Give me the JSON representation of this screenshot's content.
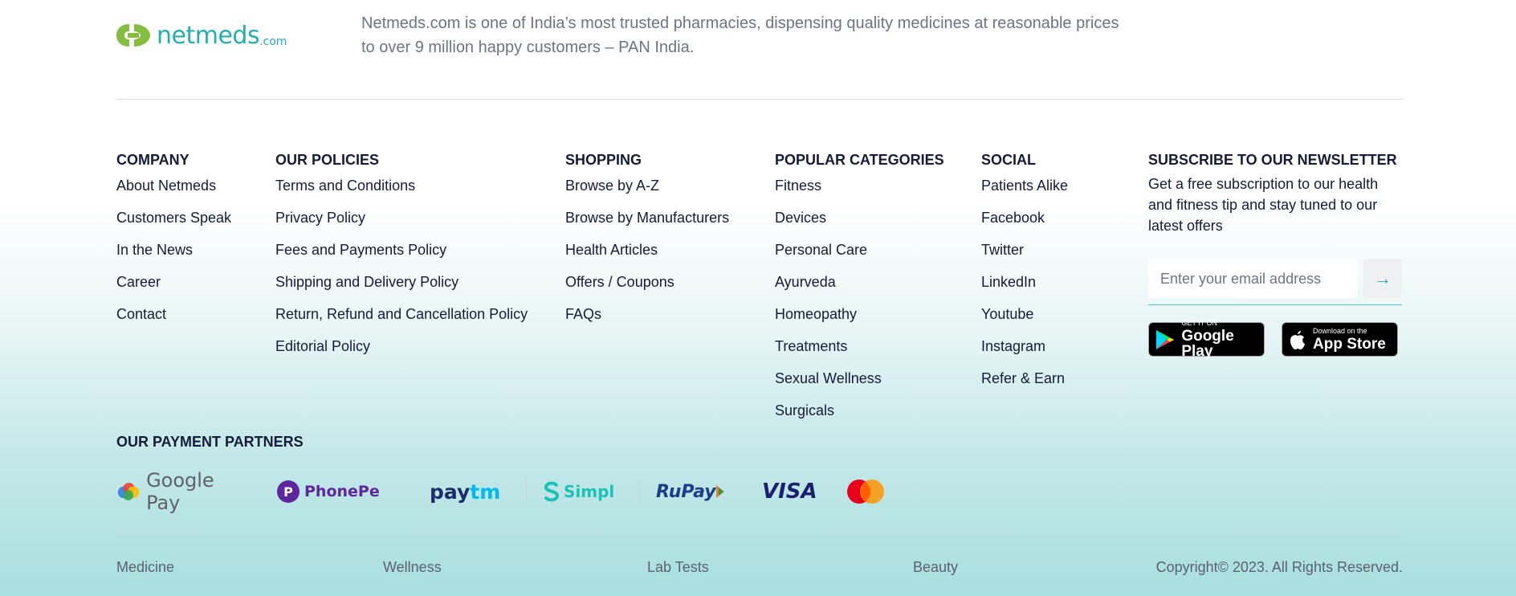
{
  "brand": {
    "name": "netmeds",
    "suffix": ".com",
    "color": "#24aeb1",
    "leaf_color": "#84be41"
  },
  "about": "Netmeds.com is one of India’s most trusted pharmacies, dispensing quality medicines at reasonable prices to over 9 million happy customers – PAN India.",
  "columns": {
    "company": {
      "title": "COMPANY",
      "links": [
        "About Netmeds",
        "Customers Speak",
        "In the News",
        "Career",
        "Contact"
      ]
    },
    "policies": {
      "title": "OUR POLICIES",
      "links": [
        "Terms and Conditions",
        "Privacy Policy",
        "Fees and Payments Policy",
        "Shipping and Delivery Policy",
        "Return, Refund and Cancellation Policy",
        "Editorial Policy"
      ]
    },
    "shopping": {
      "title": "SHOPPING",
      "links": [
        "Browse by A-Z",
        "Browse by Manufacturers",
        "Health Articles",
        "Offers / Coupons",
        "FAQs"
      ]
    },
    "categories": {
      "title": "POPULAR CATEGORIES",
      "links": [
        "Fitness",
        "Devices",
        "Personal Care",
        "Ayurveda",
        "Homeopathy",
        "Treatments",
        "Sexual Wellness",
        "Surgicals"
      ]
    },
    "social": {
      "title": "SOCIAL",
      "links": [
        "Patients Alike",
        "Facebook",
        "Twitter",
        "LinkedIn",
        "Youtube",
        "Instagram",
        "Refer & Earn"
      ]
    }
  },
  "newsletter": {
    "title": "SUBSCRIBE TO OUR NEWSLETTER",
    "text": "Get a free subscription to our health and fitness tip and stay tuned to our latest offers",
    "placeholder": "Enter your email address",
    "submit_icon": "arrow-right-icon"
  },
  "stores": {
    "google": {
      "small": "GET IT ON",
      "big": "Google Play"
    },
    "apple": {
      "small": "Download on the",
      "big": "App Store"
    }
  },
  "payments": {
    "title": "OUR PAYMENT PARTNERS",
    "gpay": "Google Pay",
    "phonepe": "PhonePe",
    "paytm_a": "pay",
    "paytm_b": "tm",
    "simpl": "Simpl",
    "rupay": "RuPay",
    "visa": "VISA"
  },
  "bottom": {
    "links": [
      "Medicine",
      "Wellness",
      "Lab Tests",
      "Beauty"
    ],
    "copyright": "Copyright© 2023. All Rights Reserved."
  }
}
